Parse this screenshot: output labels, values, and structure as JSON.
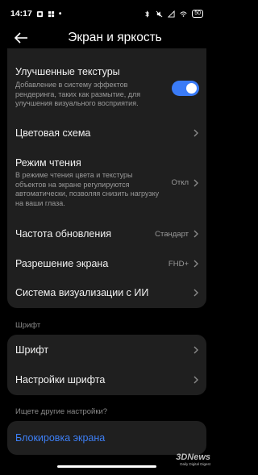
{
  "status_bar": {
    "time": "14:17",
    "battery": "50"
  },
  "header": {
    "title": "Экран и яркость"
  },
  "display_card": {
    "enhanced_textures": {
      "title": "Улучшенные текстуры",
      "description": "Добавление в систему эффектов рендеринга, таких как размытие, для улучшения визуального восприятия.",
      "enabled": true
    },
    "color_scheme": {
      "title": "Цветовая схема"
    },
    "reading_mode": {
      "title": "Режим чтения",
      "description": "В режиме чтения цвета и текстуры объектов на экране регулируются автоматически, позволяя снизить нагрузку на ваши глаза.",
      "value": "Откл"
    },
    "refresh_rate": {
      "title": "Частота обновления",
      "value": "Стандарт"
    },
    "screen_resolution": {
      "title": "Разрешение экрана",
      "value": "FHD+"
    },
    "ai_visualization": {
      "title": "Система визуализации с ИИ"
    }
  },
  "font_section": {
    "label": "Шрифт",
    "items": [
      {
        "title": "Шрифт"
      },
      {
        "title": "Настройки шрифта"
      }
    ]
  },
  "other_settings": {
    "label": "Ищете другие настройки?",
    "link": "Блокировка экрана"
  },
  "watermark": {
    "main": "3DNews",
    "sub": "Daily Digital Digest"
  },
  "colors": {
    "accent": "#3a7bf7",
    "card_bg": "#1f1f1f",
    "link": "#3d7ff5"
  }
}
